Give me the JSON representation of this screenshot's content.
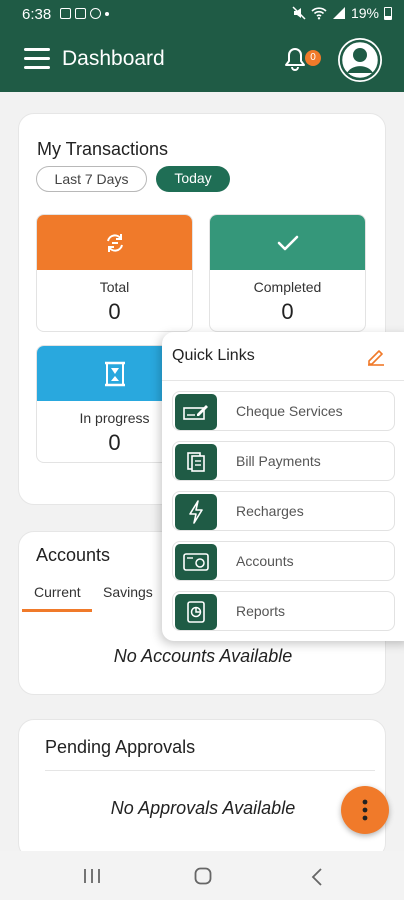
{
  "status_bar": {
    "time": "6:38",
    "battery": "19%"
  },
  "app_bar": {
    "title": "Dashboard",
    "notification_count": "0"
  },
  "transactions": {
    "title": "My Transactions",
    "filters": [
      {
        "label": "Last 7 Days"
      },
      {
        "label": "Today"
      }
    ],
    "selected_filter": "Today",
    "tiles": [
      {
        "label": "Total",
        "count": "0",
        "color": "#f07a2a"
      },
      {
        "label": "Completed",
        "count": "0",
        "color": "#35977a"
      },
      {
        "label": "In progress",
        "count": "0",
        "color": "#29a8de"
      }
    ]
  },
  "accounts": {
    "title": "Accounts",
    "tabs": [
      {
        "label": "Current"
      },
      {
        "label": "Savings"
      }
    ],
    "active_tab": "Current",
    "empty_text": "No Accounts Available"
  },
  "pending": {
    "title": "Pending Approvals",
    "empty_text": "No Approvals Available"
  },
  "quick_links": {
    "title": "Quick Links",
    "items": [
      {
        "label": "Cheque Services",
        "icon": "cheque-icon"
      },
      {
        "label": "Bill Payments",
        "icon": "bill-icon"
      },
      {
        "label": "Recharges",
        "icon": "lightning-icon"
      },
      {
        "label": "Accounts",
        "icon": "account-card-icon"
      },
      {
        "label": "Reports",
        "icon": "report-icon"
      }
    ]
  },
  "colors": {
    "brand": "#1f5b45",
    "accent": "#f07a2a",
    "chip_active": "#1f6e55"
  }
}
